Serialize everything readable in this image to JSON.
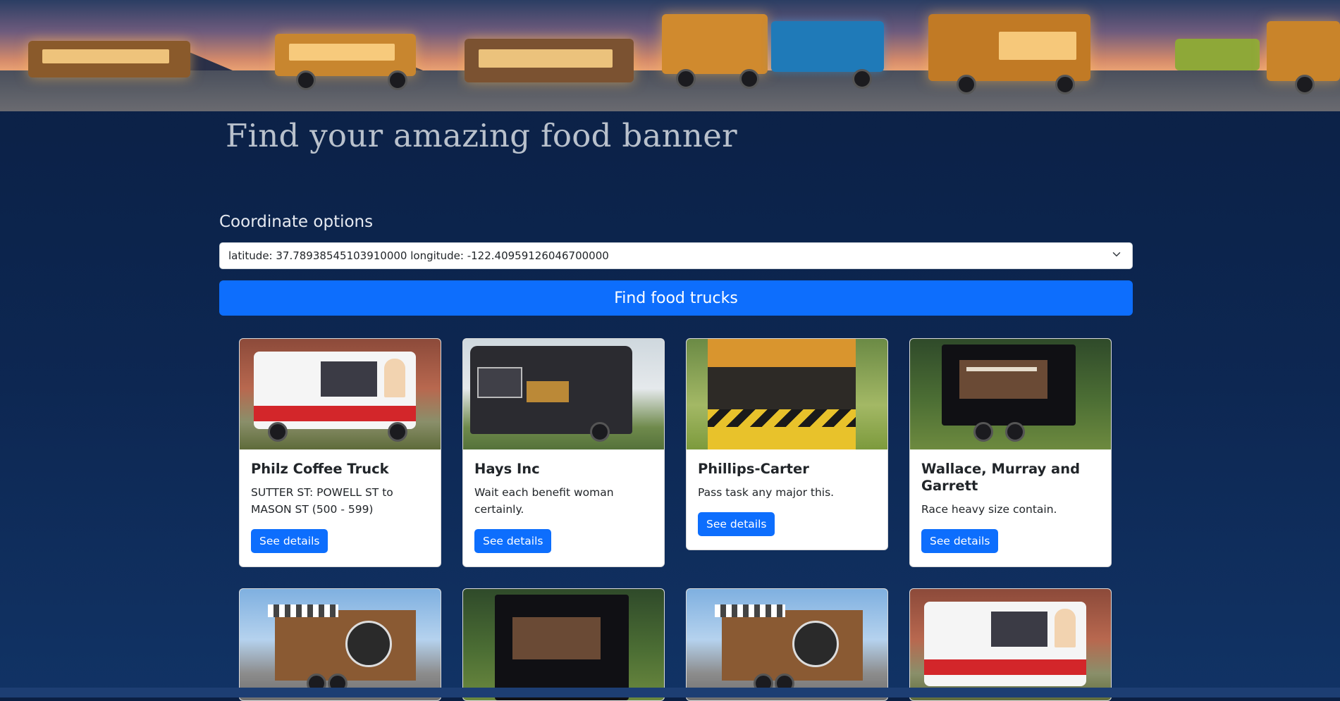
{
  "header": {
    "title": "Find your amazing food banner"
  },
  "form": {
    "coordinate_label": "Coordinate options",
    "selected_coordinate": "latitude: 37.78938545103910000 longitude: -122.40959126046700000",
    "submit_label": "Find food trucks"
  },
  "icons": {
    "select_chevron": "chevron-down-icon"
  },
  "trucks": [
    {
      "name": "Philz Coffee Truck",
      "description": "SUTTER ST: POWELL ST to MASON ST (500 - 599)",
      "button": "See details",
      "image": "ice-cream-truck-photo"
    },
    {
      "name": "Hays Inc",
      "description": "Wait each benefit woman certainly.",
      "button": "See details",
      "image": "black-taco-truck-photo"
    },
    {
      "name": "Phillips-Carter",
      "description": "Pass task any major this.",
      "button": "See details",
      "image": "food-stall-photo"
    },
    {
      "name": "Wallace, Murray and Garrett",
      "description": "Race heavy size contain.",
      "button": "See details",
      "image": "black-trailer-photo"
    },
    {
      "name": "",
      "description": "",
      "button": "",
      "image": "chicken-coop-trailer-photo"
    },
    {
      "name": "",
      "description": "",
      "button": "",
      "image": "black-trailer-photo"
    },
    {
      "name": "",
      "description": "",
      "button": "",
      "image": "chicken-coop-trailer-photo"
    },
    {
      "name": "",
      "description": "",
      "button": "",
      "image": "ice-cream-truck-photo"
    }
  ],
  "colors": {
    "background": "#0d2752",
    "primary": "#0d6efd",
    "title_text": "#b9c1cc"
  }
}
